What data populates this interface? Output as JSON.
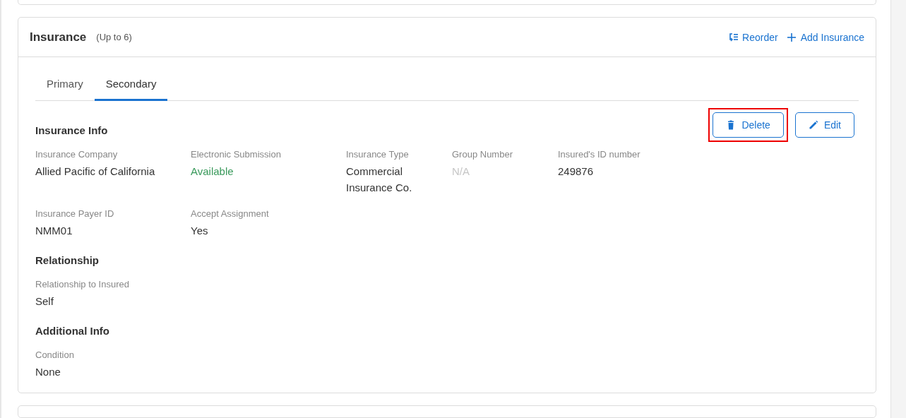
{
  "card": {
    "title": "Insurance",
    "note": "(Up to 6)"
  },
  "header_actions": [
    {
      "kind": "reorder",
      "label": "Reorder"
    },
    {
      "kind": "add",
      "label": "Add Insurance"
    }
  ],
  "tabs": [
    {
      "label": "Primary",
      "selected": false
    },
    {
      "label": "Secondary",
      "selected": true
    }
  ],
  "buttons": [
    {
      "kind": "delete",
      "label": "Delete",
      "highlighted": true
    },
    {
      "kind": "edit",
      "label": "Edit",
      "highlighted": false
    }
  ],
  "sections": [
    {
      "title": "Insurance Info",
      "rows": [
        [
          {
            "label": "Insurance Company",
            "value": "Allied Pacific of California"
          },
          {
            "label": "Electronic Submission",
            "value": "Available",
            "color": "#3a9a5c"
          },
          {
            "label": "Insurance Type",
            "value": "Commercial Insurance Co."
          },
          {
            "label": "Group Number",
            "value": "N/A",
            "color": "#c6c6c6"
          },
          {
            "label": "Insured's ID number",
            "value": "249876"
          }
        ],
        [
          {
            "label": "Insurance Payer ID",
            "value": "NMM01"
          },
          {
            "label": "Accept Assignment",
            "value": "Yes"
          }
        ]
      ]
    },
    {
      "title": "Relationship",
      "rows": [
        [
          {
            "label": "Relationship to Insured",
            "value": "Self"
          }
        ]
      ]
    },
    {
      "title": "Additional Info",
      "rows": [
        [
          {
            "label": "Condition",
            "value": "None"
          }
        ]
      ]
    }
  ]
}
